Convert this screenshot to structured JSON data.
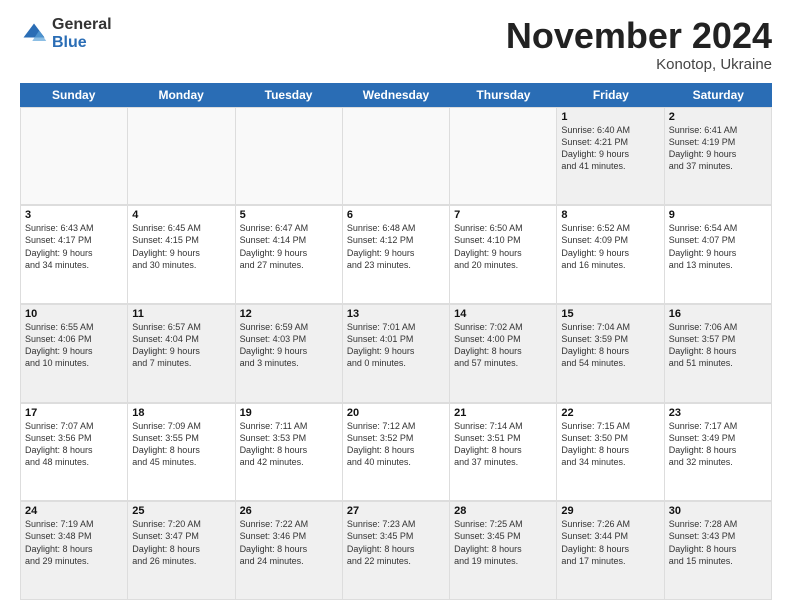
{
  "logo": {
    "general": "General",
    "blue": "Blue",
    "icon_color": "#2a6db5"
  },
  "title": "November 2024",
  "location": "Konotop, Ukraine",
  "header_days": [
    "Sunday",
    "Monday",
    "Tuesday",
    "Wednesday",
    "Thursday",
    "Friday",
    "Saturday"
  ],
  "weeks": [
    [
      {
        "day": "",
        "info": "",
        "empty": true
      },
      {
        "day": "",
        "info": "",
        "empty": true
      },
      {
        "day": "",
        "info": "",
        "empty": true
      },
      {
        "day": "",
        "info": "",
        "empty": true
      },
      {
        "day": "",
        "info": "",
        "empty": true
      },
      {
        "day": "1",
        "info": "Sunrise: 6:40 AM\nSunset: 4:21 PM\nDaylight: 9 hours\nand 41 minutes."
      },
      {
        "day": "2",
        "info": "Sunrise: 6:41 AM\nSunset: 4:19 PM\nDaylight: 9 hours\nand 37 minutes."
      }
    ],
    [
      {
        "day": "3",
        "info": "Sunrise: 6:43 AM\nSunset: 4:17 PM\nDaylight: 9 hours\nand 34 minutes."
      },
      {
        "day": "4",
        "info": "Sunrise: 6:45 AM\nSunset: 4:15 PM\nDaylight: 9 hours\nand 30 minutes."
      },
      {
        "day": "5",
        "info": "Sunrise: 6:47 AM\nSunset: 4:14 PM\nDaylight: 9 hours\nand 27 minutes."
      },
      {
        "day": "6",
        "info": "Sunrise: 6:48 AM\nSunset: 4:12 PM\nDaylight: 9 hours\nand 23 minutes."
      },
      {
        "day": "7",
        "info": "Sunrise: 6:50 AM\nSunset: 4:10 PM\nDaylight: 9 hours\nand 20 minutes."
      },
      {
        "day": "8",
        "info": "Sunrise: 6:52 AM\nSunset: 4:09 PM\nDaylight: 9 hours\nand 16 minutes."
      },
      {
        "day": "9",
        "info": "Sunrise: 6:54 AM\nSunset: 4:07 PM\nDaylight: 9 hours\nand 13 minutes."
      }
    ],
    [
      {
        "day": "10",
        "info": "Sunrise: 6:55 AM\nSunset: 4:06 PM\nDaylight: 9 hours\nand 10 minutes."
      },
      {
        "day": "11",
        "info": "Sunrise: 6:57 AM\nSunset: 4:04 PM\nDaylight: 9 hours\nand 7 minutes."
      },
      {
        "day": "12",
        "info": "Sunrise: 6:59 AM\nSunset: 4:03 PM\nDaylight: 9 hours\nand 3 minutes."
      },
      {
        "day": "13",
        "info": "Sunrise: 7:01 AM\nSunset: 4:01 PM\nDaylight: 9 hours\nand 0 minutes."
      },
      {
        "day": "14",
        "info": "Sunrise: 7:02 AM\nSunset: 4:00 PM\nDaylight: 8 hours\nand 57 minutes."
      },
      {
        "day": "15",
        "info": "Sunrise: 7:04 AM\nSunset: 3:59 PM\nDaylight: 8 hours\nand 54 minutes."
      },
      {
        "day": "16",
        "info": "Sunrise: 7:06 AM\nSunset: 3:57 PM\nDaylight: 8 hours\nand 51 minutes."
      }
    ],
    [
      {
        "day": "17",
        "info": "Sunrise: 7:07 AM\nSunset: 3:56 PM\nDaylight: 8 hours\nand 48 minutes."
      },
      {
        "day": "18",
        "info": "Sunrise: 7:09 AM\nSunset: 3:55 PM\nDaylight: 8 hours\nand 45 minutes."
      },
      {
        "day": "19",
        "info": "Sunrise: 7:11 AM\nSunset: 3:53 PM\nDaylight: 8 hours\nand 42 minutes."
      },
      {
        "day": "20",
        "info": "Sunrise: 7:12 AM\nSunset: 3:52 PM\nDaylight: 8 hours\nand 40 minutes."
      },
      {
        "day": "21",
        "info": "Sunrise: 7:14 AM\nSunset: 3:51 PM\nDaylight: 8 hours\nand 37 minutes."
      },
      {
        "day": "22",
        "info": "Sunrise: 7:15 AM\nSunset: 3:50 PM\nDaylight: 8 hours\nand 34 minutes."
      },
      {
        "day": "23",
        "info": "Sunrise: 7:17 AM\nSunset: 3:49 PM\nDaylight: 8 hours\nand 32 minutes."
      }
    ],
    [
      {
        "day": "24",
        "info": "Sunrise: 7:19 AM\nSunset: 3:48 PM\nDaylight: 8 hours\nand 29 minutes."
      },
      {
        "day": "25",
        "info": "Sunrise: 7:20 AM\nSunset: 3:47 PM\nDaylight: 8 hours\nand 26 minutes."
      },
      {
        "day": "26",
        "info": "Sunrise: 7:22 AM\nSunset: 3:46 PM\nDaylight: 8 hours\nand 24 minutes."
      },
      {
        "day": "27",
        "info": "Sunrise: 7:23 AM\nSunset: 3:45 PM\nDaylight: 8 hours\nand 22 minutes."
      },
      {
        "day": "28",
        "info": "Sunrise: 7:25 AM\nSunset: 3:45 PM\nDaylight: 8 hours\nand 19 minutes."
      },
      {
        "day": "29",
        "info": "Sunrise: 7:26 AM\nSunset: 3:44 PM\nDaylight: 8 hours\nand 17 minutes."
      },
      {
        "day": "30",
        "info": "Sunrise: 7:28 AM\nSunset: 3:43 PM\nDaylight: 8 hours\nand 15 minutes."
      }
    ]
  ]
}
